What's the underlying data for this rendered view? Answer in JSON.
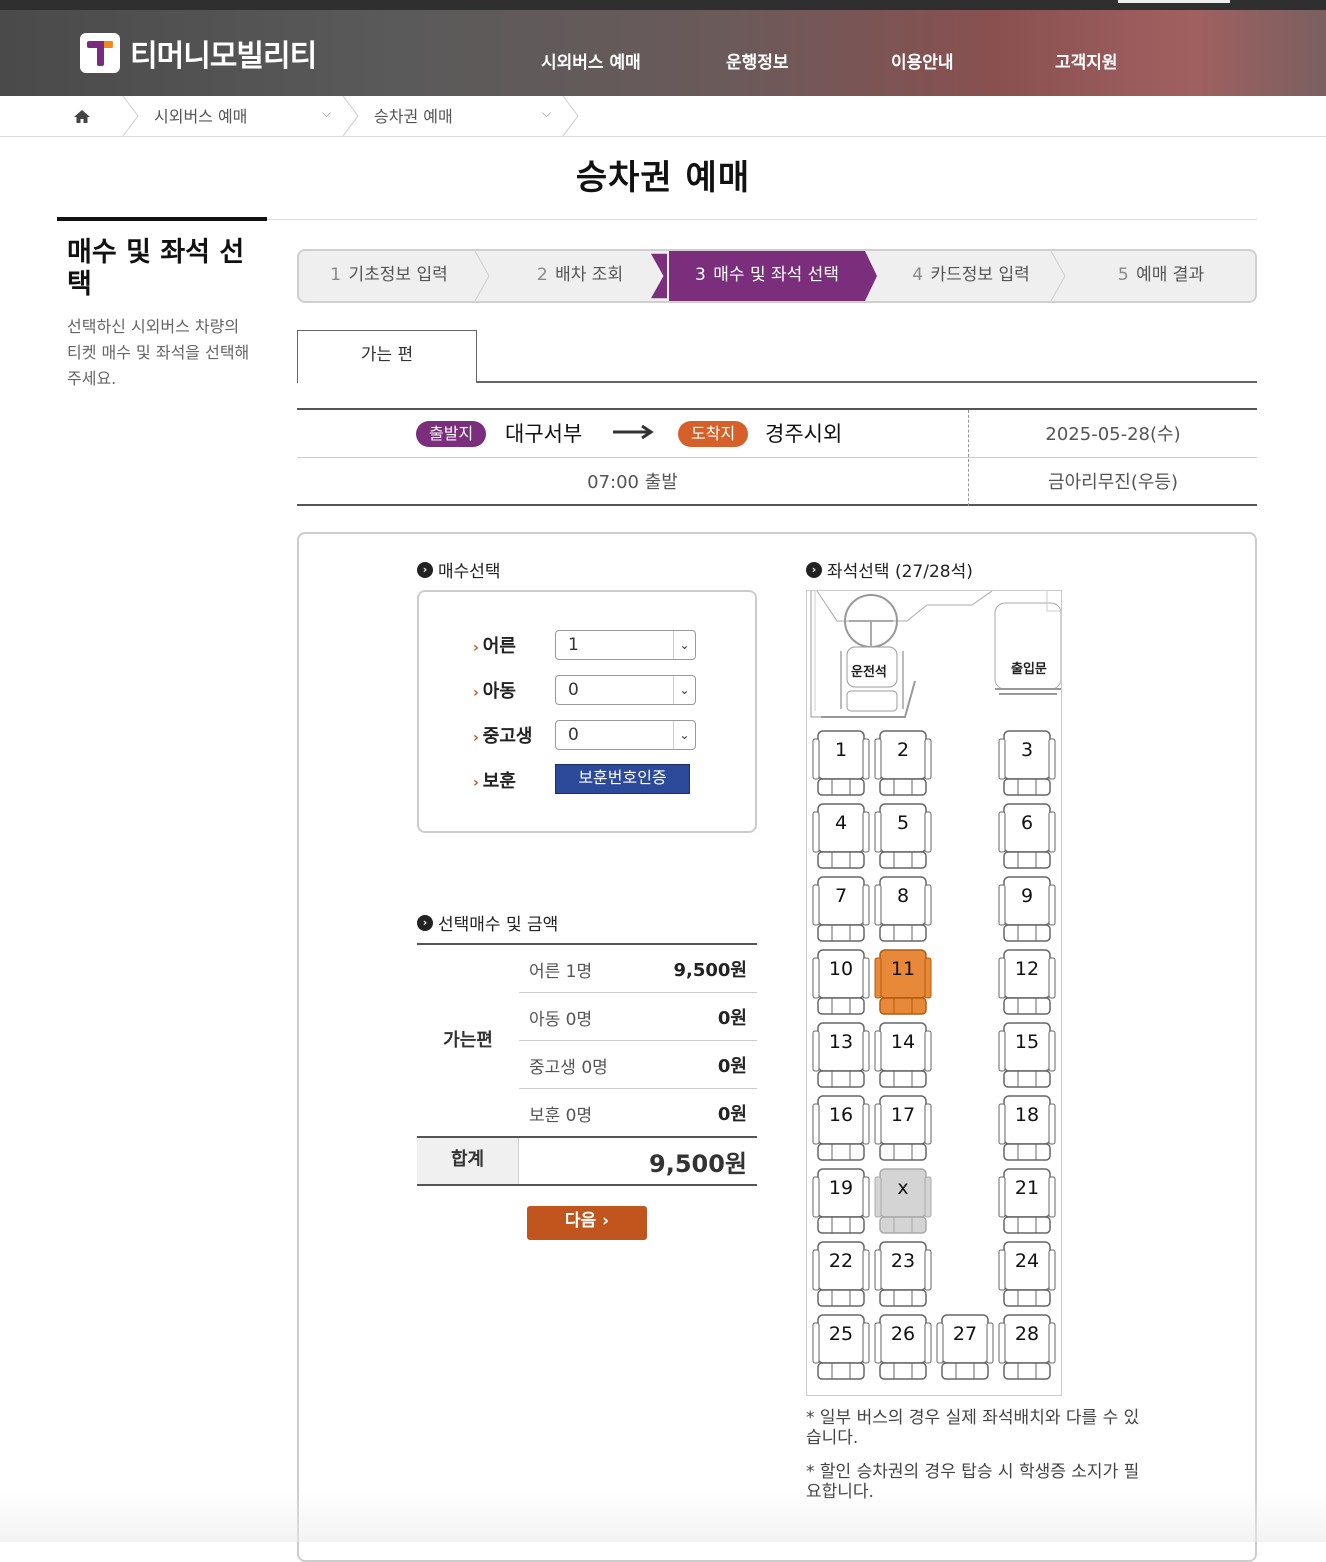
{
  "brand": {
    "name": "티머니모빌리티"
  },
  "gnb": [
    "시외버스 예매",
    "운행정보",
    "이용안내",
    "고객지원"
  ],
  "breadcrumb": {
    "level1": "시외버스 예매",
    "level2": "승차권 예매"
  },
  "page_title": "승차권 예매",
  "side": {
    "heading": "매수 및 좌석 선택",
    "description": "선택하신 시외버스 차량의 티켓 매수 및 좌석을 선택해주세요."
  },
  "steps": [
    {
      "num": "1",
      "label": "기초정보 입력"
    },
    {
      "num": "2",
      "label": "배차 조회"
    },
    {
      "num": "3",
      "label": "매수 및 좌석 선택"
    },
    {
      "num": "4",
      "label": "카드정보 입력"
    },
    {
      "num": "5",
      "label": "예매 결과"
    }
  ],
  "tab": {
    "label": "가는 편"
  },
  "route": {
    "dep_badge": "출발지",
    "dep_name": "대구서부",
    "arr_badge": "도착지",
    "arr_name": "경주시외",
    "date": "2025-05-28(수)",
    "time": "07:00 출발",
    "company": "금아리무진(우등)"
  },
  "count_section": {
    "title": "매수선택",
    "rows": [
      {
        "label": "어른",
        "value": "1"
      },
      {
        "label": "아동",
        "value": "0"
      },
      {
        "label": "중고생",
        "value": "0"
      }
    ],
    "veteran_label": "보훈",
    "veteran_button": "보훈번호인증"
  },
  "summary": {
    "title": "선택매수 및 금액",
    "side_label": "가는편",
    "rows": [
      {
        "label": "어른 1명",
        "value": "9,500원"
      },
      {
        "label": "아동 0명",
        "value": "0원"
      },
      {
        "label": "중고생 0명",
        "value": "0원"
      },
      {
        "label": "보훈 0명",
        "value": "0원"
      }
    ],
    "total_label": "합계",
    "total_value": "9,500원",
    "next_button": "다음"
  },
  "seat_section": {
    "title": "좌석선택 (27/28석)",
    "driver_label": "운전석",
    "door_label": "출입문",
    "selected_seat": "11",
    "unavailable_seat": "20",
    "seats": [
      "1",
      "2",
      "3",
      "4",
      "5",
      "6",
      "7",
      "8",
      "9",
      "10",
      "11",
      "12",
      "13",
      "14",
      "15",
      "16",
      "17",
      "18",
      "19",
      "x",
      "21",
      "22",
      "23",
      "24",
      "25",
      "26",
      "27",
      "28"
    ]
  },
  "notes": [
    "* 일부 버스의 경우 실제 좌석배치와 다를 수 있습니다.",
    "* 할인 승차권의 경우 탑승 시 학생증 소지가 필요합니다."
  ],
  "colors": {
    "brand_purple": "#7a2e7c",
    "accent_orange": "#d5602a",
    "selected_seat": "#e8893a",
    "vet_blue": "#2d4a9a"
  }
}
